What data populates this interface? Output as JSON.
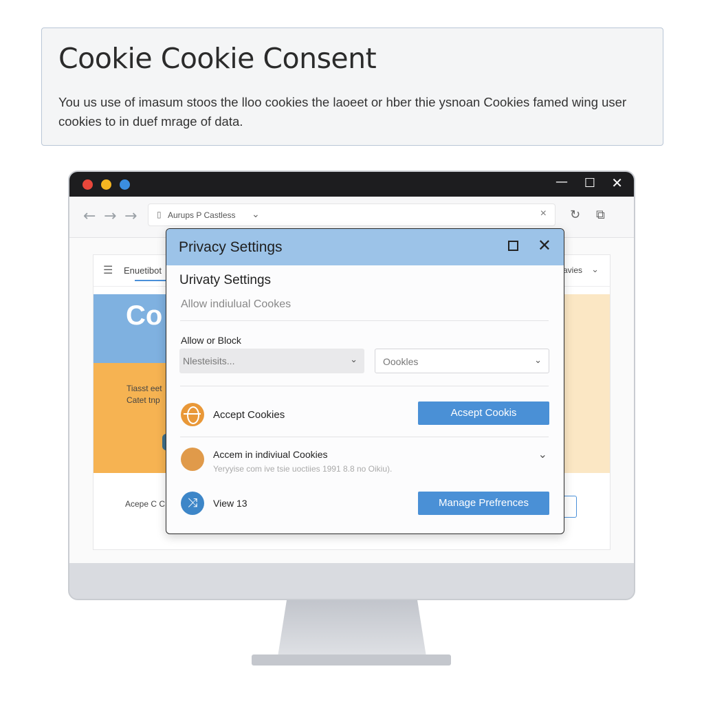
{
  "header": {
    "title": "Cookie Cookie Consent",
    "description": "You us use of imasum stoos the lloo cookies the laoeet or hber thie ysnoan Cookies famed wing user cookies to in duef mrage of data."
  },
  "window": {
    "controls": {
      "minimize": "—",
      "maximize": "☐",
      "close": "✕"
    }
  },
  "browser": {
    "address_text": "Aurups P Castless",
    "nav": {
      "back": "←",
      "forward": "→",
      "forward2": "→"
    },
    "refresh_glyph": "↻",
    "share_glyph": "⧉"
  },
  "page": {
    "nav_label": "Enuetibot",
    "nav_right": "avies",
    "hero_big": "Co",
    "hero_small": "Tiasst eet Catet tnp",
    "bottom_label": "Acepe C C"
  },
  "dialog": {
    "title": "Privacy Settings",
    "subtitle": "Urivaty Settings",
    "description": "Allow indiulual Cookes",
    "allow_block_label": "Allow or Block",
    "select1_value": "Nlesteisits...",
    "select2_value": "Oookles",
    "rows": [
      {
        "label": "Accept Cookies",
        "icon": "globe-icon",
        "button": "Acsept Cookis"
      },
      {
        "label": "Accem in indiviual Cookies",
        "sub": "Yeryyise com ive tsie uoctiies 1991 8.8 no Oikiu).",
        "icon": "cookie-icon"
      },
      {
        "label": "View 13",
        "icon": "view-icon",
        "button": "Manage Prefrences"
      }
    ]
  },
  "colors": {
    "accent": "#4a90d6",
    "dialog_header": "#9cc3e8",
    "orange": "#f6b352",
    "hero_blue": "#7fb1e0"
  }
}
